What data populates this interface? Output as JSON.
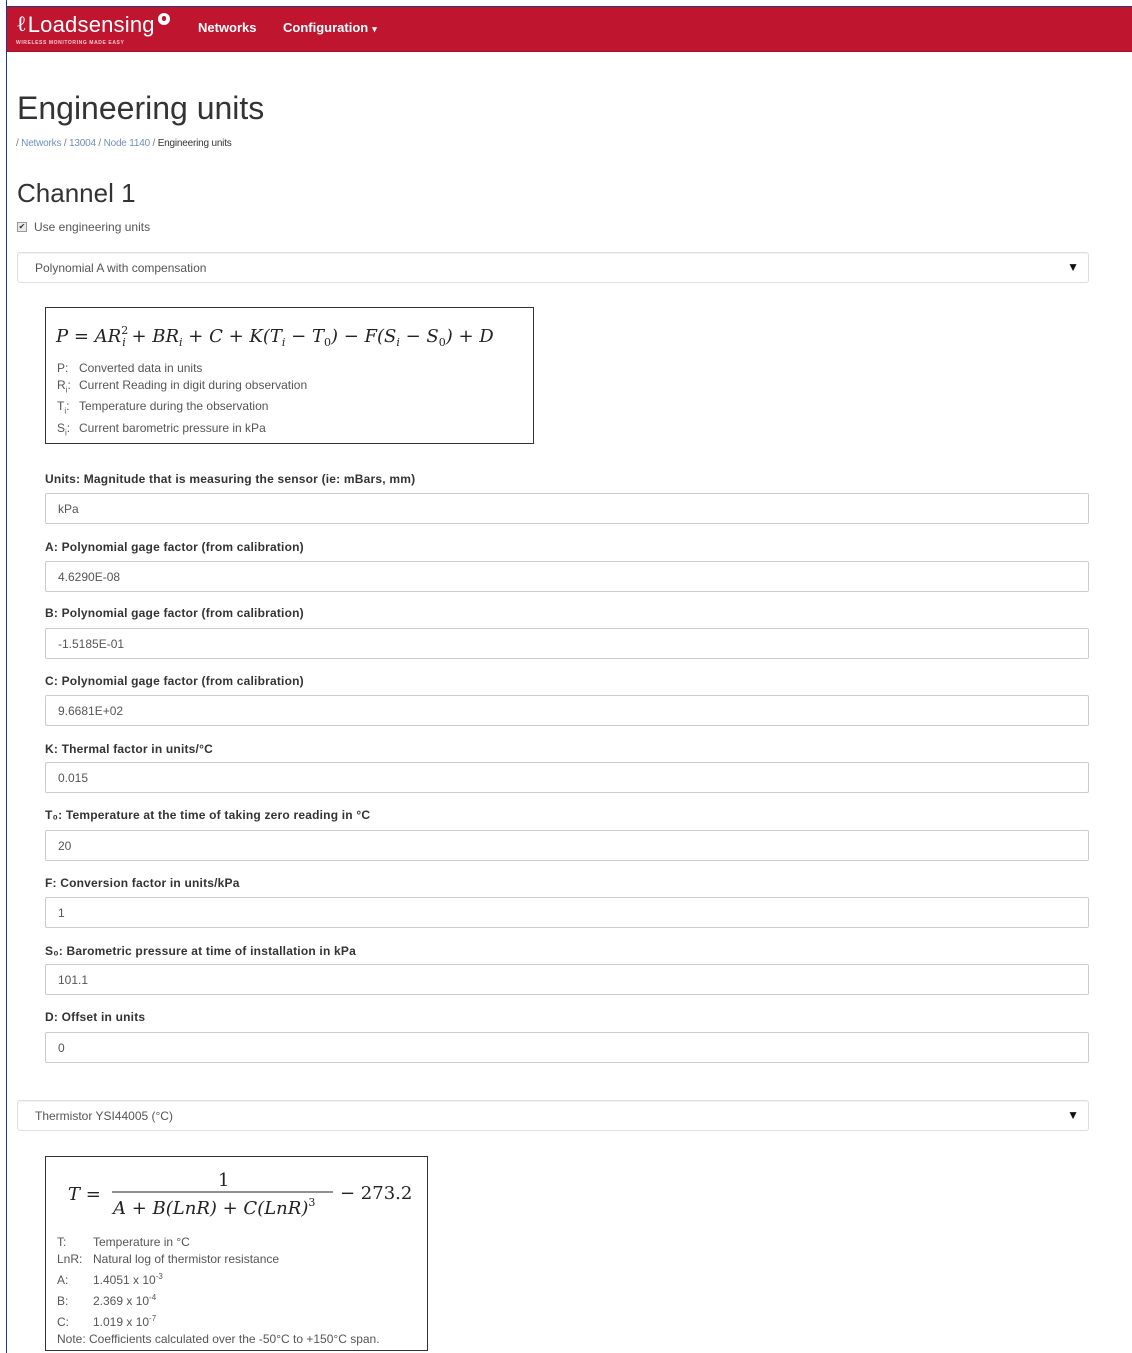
{
  "navbar": {
    "brand": "Loadsensing",
    "brand_tagline": "WIRELESS MONITORING MADE EASY",
    "items": [
      {
        "label": "Networks"
      },
      {
        "label": "Configuration"
      }
    ],
    "accent_color": "#c0152f"
  },
  "page": {
    "title": "Engineering units",
    "breadcrumb": [
      {
        "label": "Networks",
        "link": true
      },
      {
        "label": "13004",
        "link": true
      },
      {
        "label": "Node 1140",
        "link": true
      },
      {
        "label": "Engineering units",
        "link": false
      }
    ]
  },
  "channel": {
    "title": "Channel 1",
    "use_engineering_units": {
      "label": "Use engineering units",
      "checked": true
    },
    "conversion_select": {
      "value": "Polynomial A with compensation"
    },
    "formula1": {
      "equation": "P = AR²ᵢ + BRᵢ + C + K(Tᵢ − T₀) − F(Sᵢ − S₀) + D",
      "legend": [
        {
          "symbol": "P",
          "sub": "",
          "text": "Converted data in units"
        },
        {
          "symbol": "R",
          "sub": "i",
          "text": "Current Reading in digit during observation"
        },
        {
          "symbol": "T",
          "sub": "i",
          "text": "Temperature during the observation"
        },
        {
          "symbol": "S",
          "sub": "i",
          "text": "Current barometric pressure in kPa"
        }
      ]
    },
    "fields": [
      {
        "label": "Units: Magnitude that is measuring the sensor (ie: mBars, mm)",
        "value": "kPa"
      },
      {
        "label": "A: Polynomial gage factor (from calibration)",
        "value": "4.6290E-08"
      },
      {
        "label": "B: Polynomial gage factor (from calibration)",
        "value": "-1.5185E-01"
      },
      {
        "label": "C: Polynomial gage factor (from calibration)",
        "value": "9.6681E+02"
      },
      {
        "label": "K: Thermal factor in units/°C",
        "value": "0.015"
      },
      {
        "label": "T₀: Temperature at the time of taking zero reading in °C",
        "value": "20"
      },
      {
        "label": "F: Conversion factor in units/kPa",
        "value": "1"
      },
      {
        "label": "S₀: Barometric pressure at time of installation in kPa",
        "value": "101.1"
      },
      {
        "label": "D: Offset in units",
        "value": "0"
      }
    ],
    "temperature_select": {
      "value": "Thermistor YSI44005 (°C)"
    },
    "formula2": {
      "equation": "T = 1 / (A + B(LnR) + C(LnR)³) − 273.2",
      "legend": [
        {
          "symbol": "T:",
          "text": "Temperature in °C"
        },
        {
          "symbol": "LnR:",
          "text": "Natural log of thermistor resistance"
        },
        {
          "symbol": "A:",
          "text": "1.4051 x 10",
          "exp": "-3"
        },
        {
          "symbol": "B:",
          "text": "2.369 x 10",
          "exp": "-4"
        },
        {
          "symbol": "C:",
          "text": "1.019 x 10",
          "exp": "-7"
        }
      ],
      "note": "Note: Coefficients calculated over the -50°C to +150°C span."
    }
  }
}
